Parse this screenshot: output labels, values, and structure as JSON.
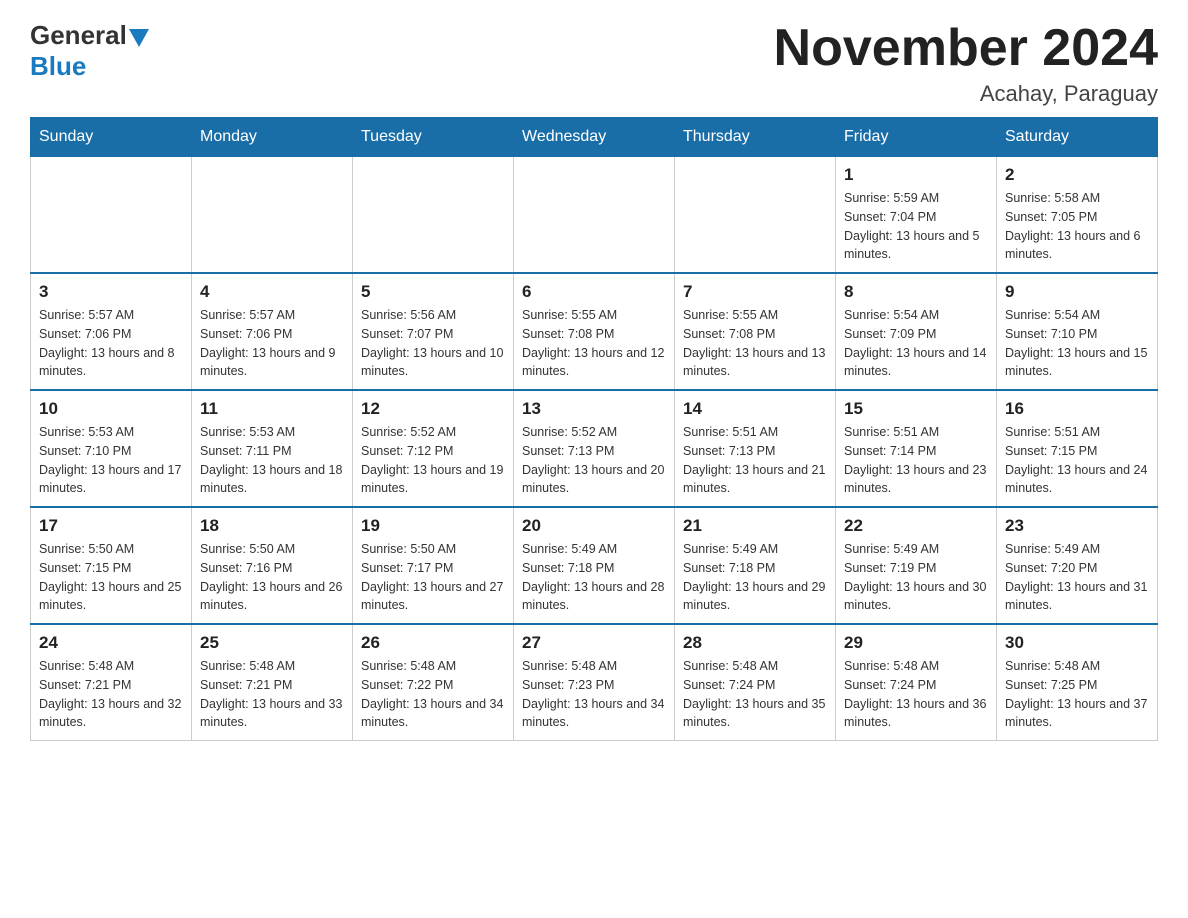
{
  "logo": {
    "general": "General",
    "blue": "Blue"
  },
  "title": "November 2024",
  "location": "Acahay, Paraguay",
  "days_of_week": [
    "Sunday",
    "Monday",
    "Tuesday",
    "Wednesday",
    "Thursday",
    "Friday",
    "Saturday"
  ],
  "weeks": [
    [
      {
        "day": "",
        "info": ""
      },
      {
        "day": "",
        "info": ""
      },
      {
        "day": "",
        "info": ""
      },
      {
        "day": "",
        "info": ""
      },
      {
        "day": "",
        "info": ""
      },
      {
        "day": "1",
        "info": "Sunrise: 5:59 AM\nSunset: 7:04 PM\nDaylight: 13 hours and 5 minutes."
      },
      {
        "day": "2",
        "info": "Sunrise: 5:58 AM\nSunset: 7:05 PM\nDaylight: 13 hours and 6 minutes."
      }
    ],
    [
      {
        "day": "3",
        "info": "Sunrise: 5:57 AM\nSunset: 7:06 PM\nDaylight: 13 hours and 8 minutes."
      },
      {
        "day": "4",
        "info": "Sunrise: 5:57 AM\nSunset: 7:06 PM\nDaylight: 13 hours and 9 minutes."
      },
      {
        "day": "5",
        "info": "Sunrise: 5:56 AM\nSunset: 7:07 PM\nDaylight: 13 hours and 10 minutes."
      },
      {
        "day": "6",
        "info": "Sunrise: 5:55 AM\nSunset: 7:08 PM\nDaylight: 13 hours and 12 minutes."
      },
      {
        "day": "7",
        "info": "Sunrise: 5:55 AM\nSunset: 7:08 PM\nDaylight: 13 hours and 13 minutes."
      },
      {
        "day": "8",
        "info": "Sunrise: 5:54 AM\nSunset: 7:09 PM\nDaylight: 13 hours and 14 minutes."
      },
      {
        "day": "9",
        "info": "Sunrise: 5:54 AM\nSunset: 7:10 PM\nDaylight: 13 hours and 15 minutes."
      }
    ],
    [
      {
        "day": "10",
        "info": "Sunrise: 5:53 AM\nSunset: 7:10 PM\nDaylight: 13 hours and 17 minutes."
      },
      {
        "day": "11",
        "info": "Sunrise: 5:53 AM\nSunset: 7:11 PM\nDaylight: 13 hours and 18 minutes."
      },
      {
        "day": "12",
        "info": "Sunrise: 5:52 AM\nSunset: 7:12 PM\nDaylight: 13 hours and 19 minutes."
      },
      {
        "day": "13",
        "info": "Sunrise: 5:52 AM\nSunset: 7:13 PM\nDaylight: 13 hours and 20 minutes."
      },
      {
        "day": "14",
        "info": "Sunrise: 5:51 AM\nSunset: 7:13 PM\nDaylight: 13 hours and 21 minutes."
      },
      {
        "day": "15",
        "info": "Sunrise: 5:51 AM\nSunset: 7:14 PM\nDaylight: 13 hours and 23 minutes."
      },
      {
        "day": "16",
        "info": "Sunrise: 5:51 AM\nSunset: 7:15 PM\nDaylight: 13 hours and 24 minutes."
      }
    ],
    [
      {
        "day": "17",
        "info": "Sunrise: 5:50 AM\nSunset: 7:15 PM\nDaylight: 13 hours and 25 minutes."
      },
      {
        "day": "18",
        "info": "Sunrise: 5:50 AM\nSunset: 7:16 PM\nDaylight: 13 hours and 26 minutes."
      },
      {
        "day": "19",
        "info": "Sunrise: 5:50 AM\nSunset: 7:17 PM\nDaylight: 13 hours and 27 minutes."
      },
      {
        "day": "20",
        "info": "Sunrise: 5:49 AM\nSunset: 7:18 PM\nDaylight: 13 hours and 28 minutes."
      },
      {
        "day": "21",
        "info": "Sunrise: 5:49 AM\nSunset: 7:18 PM\nDaylight: 13 hours and 29 minutes."
      },
      {
        "day": "22",
        "info": "Sunrise: 5:49 AM\nSunset: 7:19 PM\nDaylight: 13 hours and 30 minutes."
      },
      {
        "day": "23",
        "info": "Sunrise: 5:49 AM\nSunset: 7:20 PM\nDaylight: 13 hours and 31 minutes."
      }
    ],
    [
      {
        "day": "24",
        "info": "Sunrise: 5:48 AM\nSunset: 7:21 PM\nDaylight: 13 hours and 32 minutes."
      },
      {
        "day": "25",
        "info": "Sunrise: 5:48 AM\nSunset: 7:21 PM\nDaylight: 13 hours and 33 minutes."
      },
      {
        "day": "26",
        "info": "Sunrise: 5:48 AM\nSunset: 7:22 PM\nDaylight: 13 hours and 34 minutes."
      },
      {
        "day": "27",
        "info": "Sunrise: 5:48 AM\nSunset: 7:23 PM\nDaylight: 13 hours and 34 minutes."
      },
      {
        "day": "28",
        "info": "Sunrise: 5:48 AM\nSunset: 7:24 PM\nDaylight: 13 hours and 35 minutes."
      },
      {
        "day": "29",
        "info": "Sunrise: 5:48 AM\nSunset: 7:24 PM\nDaylight: 13 hours and 36 minutes."
      },
      {
        "day": "30",
        "info": "Sunrise: 5:48 AM\nSunset: 7:25 PM\nDaylight: 13 hours and 37 minutes."
      }
    ]
  ]
}
